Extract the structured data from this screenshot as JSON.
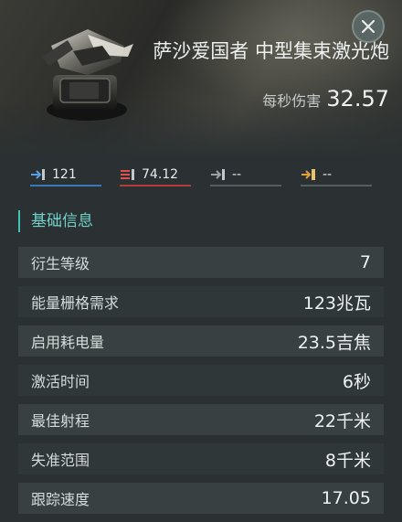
{
  "item": {
    "name": "萨沙爱国者 中型集束激光炮",
    "icon": "laser-turret-icon"
  },
  "dps": {
    "label": "每秒伤害",
    "value": "32.57"
  },
  "damage": [
    {
      "icon": "em-damage-icon",
      "value": "121",
      "color": "#3a78b8"
    },
    {
      "icon": "thermal-damage-icon",
      "value": "74.12",
      "color": "#b63c3c"
    },
    {
      "icon": "kinetic-damage-icon",
      "value": "--"
    },
    {
      "icon": "explosive-damage-icon",
      "value": "--"
    }
  ],
  "section": {
    "title": "基础信息"
  },
  "attributes": [
    {
      "label": "衍生等级",
      "value": "7"
    },
    {
      "label": "能量栅格需求",
      "value": "123兆瓦"
    },
    {
      "label": "启用耗电量",
      "value": "23.5吉焦"
    },
    {
      "label": "激活时间",
      "value": "6秒"
    },
    {
      "label": "最佳射程",
      "value": "22千米"
    },
    {
      "label": "失准范围",
      "value": "8千米"
    },
    {
      "label": "跟踪速度",
      "value": "17.05"
    }
  ],
  "colors": {
    "accent": "#3fc2b8",
    "background": "#2b3132"
  }
}
